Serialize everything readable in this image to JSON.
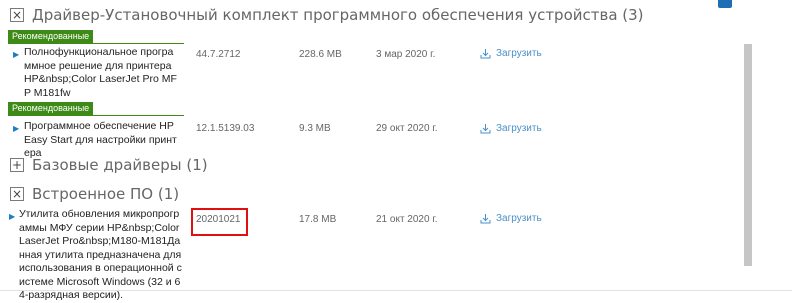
{
  "sections": [
    {
      "toggle": "×",
      "title": "Драйвер-Установочный комплект программного обеспечения устройства (3)"
    },
    {
      "toggle": "+",
      "title": "Базовые драйверы (1)"
    },
    {
      "toggle": "×",
      "title": "Встроенное ПО (1)"
    }
  ],
  "badge_label": "Рекомендованные",
  "download_label": "Загрузить",
  "rows": [
    {
      "name": "Полнофункциональное программное решение для принтера HP&nbsp;Color LaserJet Pro MFP M181fw",
      "version": "44.7.2712",
      "size": "228.6 MB",
      "date": "3 мар 2020 г."
    },
    {
      "name": "Программное обеспечение HP Easy Start для настройки принтера",
      "version": "12.1.5139.03",
      "size": "9.3 MB",
      "date": "29 окт 2020 г."
    },
    {
      "name": "Утилита обновления микропрограммы МФУ серии HP&nbsp;Color LaserJet Pro&nbsp;M180-M181Данная утилита предназначена для использования в операционной системе Microsoft Windows (32 и 64-разрядная версии).",
      "version": "20201021",
      "size": "17.8 MB",
      "date": "21 окт 2020 г."
    }
  ]
}
